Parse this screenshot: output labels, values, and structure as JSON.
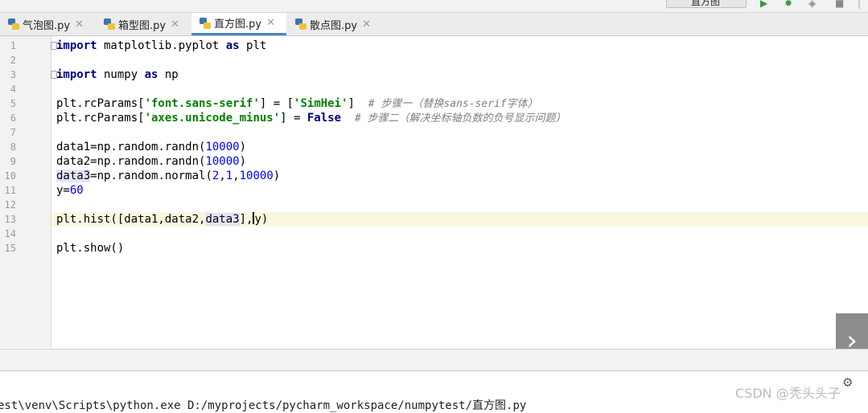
{
  "toolbar": {
    "run_config": "直方图",
    "icons": [
      "run-icon",
      "debug-icon",
      "coverage-icon",
      "stop-icon"
    ]
  },
  "tabs": [
    {
      "label": "气泡图.py",
      "active": false
    },
    {
      "label": "箱型图.py",
      "active": false
    },
    {
      "label": "直方图.py",
      "active": true
    },
    {
      "label": "散点图.py",
      "active": false
    }
  ],
  "editor": {
    "line_numbers": [
      "1",
      "2",
      "3",
      "4",
      "5",
      "6",
      "7",
      "8",
      "9",
      "10",
      "11",
      "12",
      "13",
      "14",
      "15"
    ],
    "current_line": "13",
    "code": {
      "l1_kw": "import",
      "l1_rest": " matplotlib.pyplot ",
      "l1_kw2": "as",
      "l1_end": " plt",
      "l3_kw": "import",
      "l3_rest": " numpy ",
      "l3_kw2": "as",
      "l3_end": " np",
      "l5_a": "plt.rcParams[",
      "l5_str": "'font.sans-serif'",
      "l5_b": "] = [",
      "l5_str2": "'SimHei'",
      "l5_c": "]  ",
      "l5_cmt": "# 步骤一（替换sans-serif字体）",
      "l6_a": "plt.rcParams[",
      "l6_str": "'axes.unicode_minus'",
      "l6_b": "] = ",
      "l6_kw": "False",
      "l6_c": "  ",
      "l6_cmt": "# 步骤二（解决坐标轴负数的负号显示问题）",
      "l8_a": "data1=np.random.randn(",
      "l8_num": "10000",
      "l8_b": ")",
      "l9_a": "data2=np.random.randn(",
      "l9_num": "10000",
      "l9_b": ")",
      "l10_hl": "data3",
      "l10_a": "=np.random.normal(",
      "l10_n1": "2",
      "l10_c1": ",",
      "l10_n2": "1",
      "l10_c2": ",",
      "l10_n3": "10000",
      "l10_b": ")",
      "l11_a": "y=",
      "l11_num": "60",
      "l13_a": "plt.hist([data1,data2,",
      "l13_hl": "data3",
      "l13_b": "],",
      "l13_c": "y)",
      "l15_a": "plt.show()"
    }
  },
  "console": {
    "text": "est\\venv\\Scripts\\python.exe D:/myprojects/pycharm_workspace/numpytest/直方图.py"
  },
  "watermark": "CSDN @秃头头子"
}
